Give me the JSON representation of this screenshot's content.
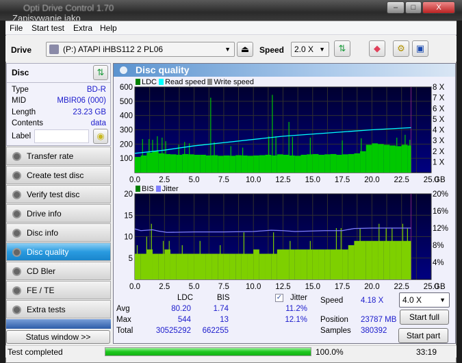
{
  "window": {
    "title": "Opti Drive Control 1.70",
    "overlay_title": "Zapisywanie jako",
    "minimize": "–",
    "maximize": "□",
    "close": "X"
  },
  "menu": [
    "File",
    "Start test",
    "Extra",
    "Help"
  ],
  "toolbar": {
    "drive_label": "Drive",
    "drive_value": "(P:)   ATAPI iHBS112   2 PL06",
    "speed_label": "Speed",
    "speed_value": "2.0 X",
    "icons": [
      "refresh-icon",
      "eraser-icon",
      "settings-icon",
      "save-icon"
    ]
  },
  "disc": {
    "title": "Disc",
    "rows": [
      {
        "k": "Type",
        "v": "BD-R"
      },
      {
        "k": "MID",
        "v": "MBIR06 (000)"
      },
      {
        "k": "Length",
        "v": "23.23 GB"
      },
      {
        "k": "Contents",
        "v": "data"
      }
    ],
    "label_key": "Label",
    "label_value": ""
  },
  "nav": [
    {
      "label": "Transfer rate"
    },
    {
      "label": "Create test disc"
    },
    {
      "label": "Verify test disc"
    },
    {
      "label": "Drive info"
    },
    {
      "label": "Disc info"
    },
    {
      "label": "Disc quality",
      "active": true
    },
    {
      "label": "CD Bler"
    },
    {
      "label": "FE / TE"
    },
    {
      "label": "Extra tests"
    }
  ],
  "status_window": "Status window >>",
  "main": {
    "title": "Disc quality"
  },
  "colors": {
    "ldc": "#00c800",
    "read": "#00ffff",
    "write": "#888888",
    "bis": "#7ed000",
    "jitter": "#8080ff",
    "plot_bg": "#000060"
  },
  "chart_data": [
    {
      "type": "bar",
      "legend": [
        "LDC",
        "Read speed",
        "Write speed"
      ],
      "xlim": [
        0,
        25
      ],
      "ylim": [
        0,
        600
      ],
      "y2lim": [
        0,
        8
      ],
      "xticks": [
        "0.0",
        "2.5",
        "5.0",
        "7.5",
        "10.0",
        "12.5",
        "15.0",
        "17.5",
        "20.0",
        "22.5",
        "25.0"
      ],
      "xunit": "GB",
      "yticks": [
        "100",
        "200",
        "300",
        "400",
        "500",
        "600"
      ],
      "y2ticks": [
        "1 X",
        "2 X",
        "3 X",
        "4 X",
        "5 X",
        "6 X",
        "7 X",
        "8 X"
      ],
      "ldc_step": 0.5,
      "ldc_baseline": [
        110,
        120,
        140,
        150,
        135,
        130,
        128,
        125,
        130,
        128,
        125,
        125,
        120,
        122,
        118,
        120,
        118,
        122,
        120,
        118,
        120,
        122,
        125,
        120,
        128,
        125,
        120,
        118,
        125,
        128,
        130,
        125,
        128,
        130,
        125,
        128,
        130,
        135,
        150,
        195,
        205,
        200,
        195,
        190,
        185,
        195,
        190
      ],
      "ldc_spikes": [
        [
          0.65,
          235
        ],
        [
          1.2,
          235
        ],
        [
          1.5,
          230
        ],
        [
          1.9,
          255
        ],
        [
          2.3,
          245
        ],
        [
          2.6,
          220
        ],
        [
          3.7,
          195
        ],
        [
          4.2,
          215
        ],
        [
          4.6,
          205
        ],
        [
          6.4,
          525
        ],
        [
          6.7,
          215
        ],
        [
          8.1,
          185
        ],
        [
          9.1,
          175
        ],
        [
          11.3,
          255
        ],
        [
          11.6,
          545
        ],
        [
          11.9,
          255
        ],
        [
          13.0,
          355
        ],
        [
          13.3,
          250
        ],
        [
          14.8,
          245
        ],
        [
          17.5,
          225
        ],
        [
          19.1,
          240
        ],
        [
          22.1,
          245
        ],
        [
          22.8,
          265
        ],
        [
          23.2,
          230
        ]
      ],
      "read_speed": [
        [
          0,
          1.8
        ],
        [
          2.5,
          2.1
        ],
        [
          5,
          2.5
        ],
        [
          7.5,
          2.8
        ],
        [
          10,
          3.1
        ],
        [
          12.5,
          3.4
        ],
        [
          15,
          3.6
        ],
        [
          17.5,
          3.8
        ],
        [
          20,
          4.0
        ],
        [
          23.3,
          4.2
        ]
      ],
      "end": 23.3
    },
    {
      "type": "bar",
      "legend": [
        "BIS",
        "Jitter"
      ],
      "xlim": [
        0,
        25
      ],
      "ylim": [
        0,
        20
      ],
      "y2lim": [
        0,
        20
      ],
      "xticks": [
        "0.0",
        "2.5",
        "5.0",
        "7.5",
        "10.0",
        "12.5",
        "15.0",
        "17.5",
        "20.0",
        "22.5",
        "25.0"
      ],
      "xunit": "GB",
      "yticks": [
        "5",
        "10",
        "15",
        "20"
      ],
      "y2ticks": [
        "4%",
        "8%",
        "12%",
        "16%",
        "20%"
      ],
      "bis_step": 0.5,
      "bis_baseline": [
        6,
        6,
        7,
        6,
        6,
        7,
        6,
        6,
        6,
        6,
        6,
        6,
        6,
        6,
        6,
        6,
        6,
        6,
        6,
        6,
        7,
        6,
        6,
        6,
        7,
        7,
        7,
        7,
        7,
        7,
        7,
        7,
        7,
        7,
        7,
        7,
        8,
        9,
        9,
        9,
        9,
        9,
        9,
        9,
        9,
        9,
        9
      ],
      "bis_spikes": [
        [
          0.2,
          8
        ],
        [
          1.0,
          10
        ],
        [
          1.4,
          13
        ],
        [
          2.4,
          9
        ],
        [
          2.9,
          9
        ],
        [
          4.0,
          8
        ],
        [
          5.5,
          9
        ],
        [
          7.2,
          8
        ],
        [
          9.2,
          11
        ],
        [
          11.7,
          11
        ],
        [
          13.1,
          9
        ],
        [
          14.8,
          9
        ],
        [
          17.0,
          12
        ],
        [
          17.4,
          12
        ],
        [
          19.0,
          12
        ],
        [
          20.6,
          13
        ],
        [
          21.2,
          12
        ],
        [
          21.7,
          12
        ],
        [
          22.6,
          13
        ],
        [
          23.0,
          12
        ]
      ],
      "jitter": [
        [
          0,
          11.8
        ],
        [
          0.5,
          11.4
        ],
        [
          1.5,
          11.6
        ],
        [
          2.0,
          11.3
        ],
        [
          2.7,
          11.0
        ],
        [
          5,
          11.1
        ],
        [
          7.5,
          11.1
        ],
        [
          10,
          11.2
        ],
        [
          11.5,
          11.5
        ],
        [
          12.5,
          11.4
        ],
        [
          13.5,
          11.2
        ],
        [
          16,
          11.4
        ],
        [
          17.5,
          11.4
        ],
        [
          18.5,
          11.9
        ],
        [
          20,
          12.0
        ],
        [
          23.3,
          12.0
        ]
      ],
      "end": 23.3
    }
  ],
  "stats": {
    "col_ldc": "LDC",
    "col_bis": "BIS",
    "jitter_label": "Jitter",
    "jitter_checked": true,
    "rows": [
      {
        "k": "Avg",
        "ldc": "80.20",
        "bis": "1.74",
        "jit": "11.2%"
      },
      {
        "k": "Max",
        "ldc": "544",
        "bis": "13",
        "jit": "12.1%"
      },
      {
        "k": "Total",
        "ldc": "30525292",
        "bis": "662255",
        "jit": ""
      }
    ],
    "speed_label": "Speed",
    "speed_value": "4.18 X",
    "position_label": "Position",
    "position_value": "23787 MB",
    "samples_label": "Samples",
    "samples_value": "380392",
    "speed_select": "4.0 X",
    "start_full": "Start full",
    "start_part": "Start part"
  },
  "statusbar": {
    "text": "Test completed",
    "progress": 100.0,
    "progress_text": "100.0%",
    "time": "33:19"
  }
}
